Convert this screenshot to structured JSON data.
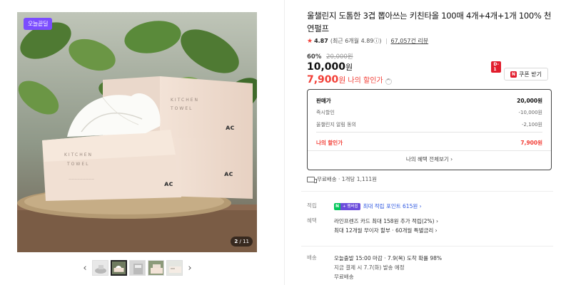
{
  "gallery": {
    "badge": "오늘끝딜",
    "counter_current": "2",
    "counter_total": "/ 11",
    "prev_symbol": "‹",
    "next_symbol": "›"
  },
  "product": {
    "title": "울챌린지 도톰한 3겹 뽑아쓰는 키친타올 100매 4개+4개+1개 100% 천연펄프",
    "rating": "4.87",
    "rating_detail": "(최근 6개월 4.89ⓘ)",
    "reviews": "67,057건 리뷰"
  },
  "price": {
    "discount_rate": "60%",
    "original_price": "20,000원",
    "sale_amount": "10,000",
    "sale_unit": "원",
    "my_amount": "7,900",
    "my_unit": "원",
    "my_label": "나의 할인가",
    "my_caret": "^",
    "coupon_dday": "D-1",
    "coupon_n": "N",
    "coupon_label": "쿠폰 받기"
  },
  "price_box": {
    "head_label": "판매가",
    "head_value": "20,000원",
    "rows": [
      {
        "label": "즉시할인",
        "value": "-10,000원"
      },
      {
        "label": "울챌린지 알림 동의",
        "value": "-2,100원"
      }
    ],
    "final_label": "나의 할인가",
    "final_value": "7,900원",
    "more_link": "나의 혜택 전체보기 ›"
  },
  "shipping_summary": "무료배송 · 1개당 1,111원",
  "points": {
    "label": "적립",
    "badge_n": "N",
    "badge_pay": "+ 멤버쉽",
    "text": "최대 적립 포인트 615원 ›"
  },
  "benefits": {
    "label": "혜택",
    "line1": "라인프렌즈 카드 최대 158원 추가 적립(2%) ›",
    "line2": "최대 12개월 무이자 할부 · 60개월 특별금리 ›"
  },
  "delivery": {
    "label": "배송",
    "line1": "오늘출발 15:00 마감 · 7.9(목) 도착 확률 98%",
    "line2": "지금 결제 시 7.7(화) 발송 예정",
    "line3": "무료배송"
  },
  "colors": {
    "accent_red": "#f23f37",
    "badge_purple": "#7b4dff",
    "naver_green": "#03c75a",
    "point_blue": "#2f58e0"
  }
}
